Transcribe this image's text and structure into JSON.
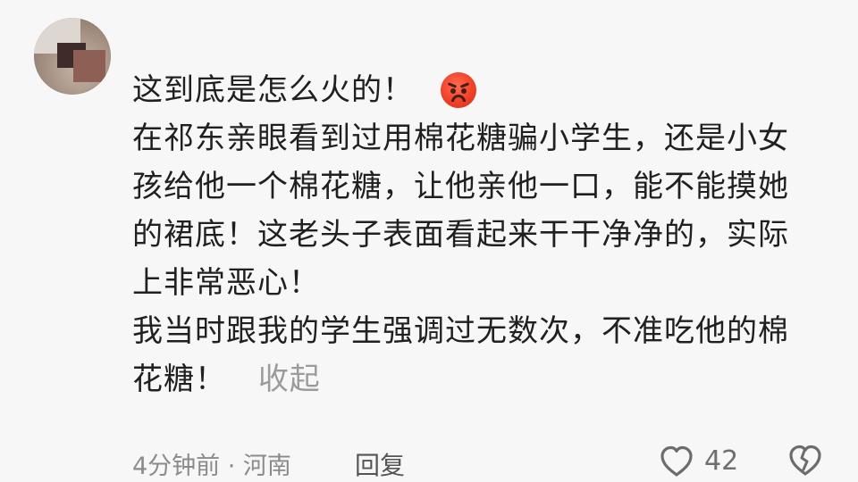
{
  "comment": {
    "lines": [
      "这到底是怎么火的！",
      "在祁东亲眼看到过用棉花糖骗小学生，还是小女",
      "孩给他一个棉花糖，让他亲他一口，能不能摸她",
      "的裙底！这老头子表面看起来干干净净的，实际",
      "上非常恶心！",
      "我当时跟我的学生强调过无数次，不准吃他的棉",
      "花糖！"
    ],
    "emoji": "angry-face",
    "collapse_label": "收起"
  },
  "meta": {
    "time_location": "4分钟前 · 河南",
    "reply_label": "回复",
    "like_count": "42"
  },
  "icons": {
    "like": "heart-outline-icon",
    "dislike": "broken-heart-outline-icon"
  }
}
